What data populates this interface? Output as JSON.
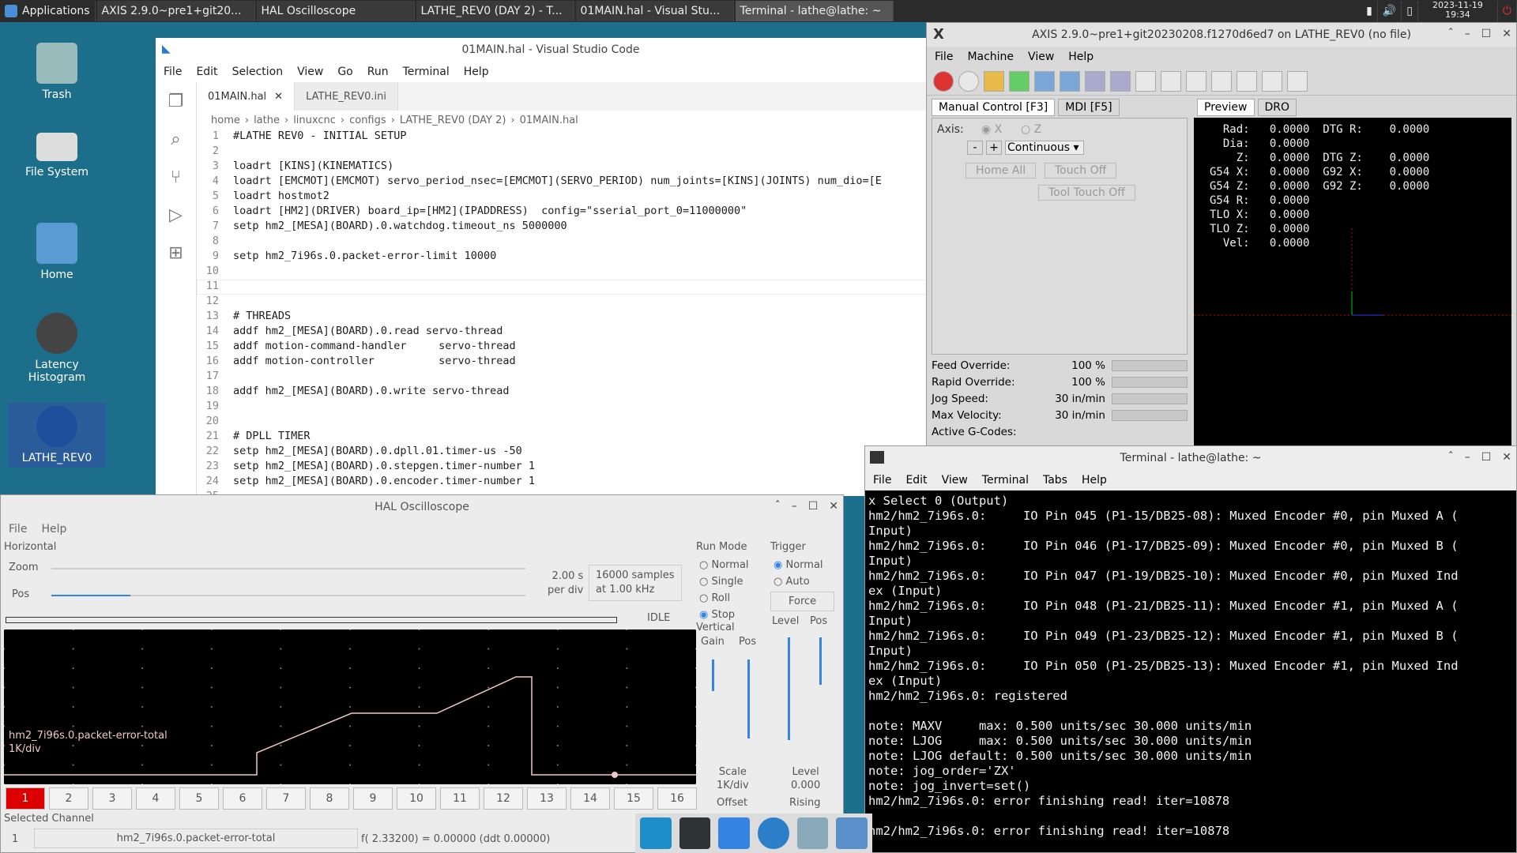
{
  "panel": {
    "applications": "Applications",
    "tasks": [
      "AXIS 2.9.0~pre1+git20...",
      "HAL Oscilloscope",
      "LATHE_REV0 (DAY 2) - T...",
      "01MAIN.hal - Visual Stu...",
      "Terminal - lathe@lathe: ~"
    ],
    "date": "2023-11-19",
    "time": "19:34"
  },
  "desktop_icons": [
    "Trash",
    "File System",
    "Home",
    "Latency Histogram",
    "LATHE_REV0"
  ],
  "vscode": {
    "title": "01MAIN.hal - Visual Studio Code",
    "menus": [
      "File",
      "Edit",
      "Selection",
      "View",
      "Go",
      "Run",
      "Terminal",
      "Help"
    ],
    "tabs": [
      "01MAIN.hal",
      "LATHE_REV0.ini"
    ],
    "breadcrumb": [
      "home",
      "lathe",
      "linuxcnc",
      "configs",
      "LATHE_REV0 (DAY 2)",
      "01MAIN.hal"
    ],
    "lines": [
      "#LATHE REV0 - INITIAL SETUP",
      "",
      "loadrt [KINS](KINEMATICS)",
      "loadrt [EMCMOT](EMCMOT) servo_period_nsec=[EMCMOT](SERVO_PERIOD) num_joints=[KINS](JOINTS) num_dio=[E",
      "loadrt hostmot2",
      "loadrt [HM2](DRIVER) board_ip=[HM2](IPADDRESS)  config=\"sserial_port_0=11000000\"",
      "setp hm2_[MESA](BOARD).0.watchdog.timeout_ns 5000000",
      "",
      "setp hm2_7i96s.0.packet-error-limit 10000",
      "",
      "",
      "",
      "# THREADS",
      "addf hm2_[MESA](BOARD).0.read servo-thread",
      "addf motion-command-handler     servo-thread",
      "addf motion-controller          servo-thread",
      "",
      "addf hm2_[MESA](BOARD).0.write servo-thread",
      "",
      "",
      "# DPLL TIMER",
      "setp hm2_[MESA](BOARD).0.dpll.01.timer-us -50",
      "setp hm2_[MESA](BOARD).0.stepgen.timer-number 1",
      "setp hm2_[MESA](BOARD).0.encoder.timer-number 1"
    ]
  },
  "axis": {
    "title": "AXIS 2.9.0~pre1+git20230208.f1270d6ed7 on LATHE_REV0 (no file)",
    "menus": [
      "File",
      "Machine",
      "View",
      "Help"
    ],
    "tabs": [
      "Manual Control [F3]",
      "MDI [F5]"
    ],
    "view_tabs": [
      "Preview",
      "DRO"
    ],
    "axis_label": "Axis:",
    "axes": [
      "X",
      "Z"
    ],
    "jog_mode": "Continuous",
    "buttons": [
      "Home All",
      "Touch Off",
      "Tool Touch Off"
    ],
    "overrides": [
      {
        "label": "Feed Override:",
        "value": "100 %"
      },
      {
        "label": "Rapid Override:",
        "value": "100 %"
      },
      {
        "label": "Jog Speed:",
        "value": "30 in/min"
      },
      {
        "label": "Max Velocity:",
        "value": "30 in/min"
      }
    ],
    "gcodes_label": "Active G-Codes:",
    "dro": "  Rad:   0.0000  DTG R:    0.0000\n  Dia:   0.0000\n    Z:   0.0000  DTG Z:    0.0000\nG54 X:   0.0000  G92 X:    0.0000\nG54 Z:   0.0000  G92 Z:    0.0000\nG54 R:   0.0000\nTLO X:   0.0000\nTLO Z:   0.0000\n  Vel:   0.0000"
  },
  "terminal": {
    "title": "Terminal - lathe@lathe: ~",
    "menus": [
      "File",
      "Edit",
      "View",
      "Terminal",
      "Tabs",
      "Help"
    ],
    "text": "x Select 0 (Output)\nhm2/hm2_7i96s.0:     IO Pin 045 (P1-15/DB25-08): Muxed Encoder #0, pin Muxed A (\nInput)\nhm2/hm2_7i96s.0:     IO Pin 046 (P1-17/DB25-09): Muxed Encoder #0, pin Muxed B (\nInput)\nhm2/hm2_7i96s.0:     IO Pin 047 (P1-19/DB25-10): Muxed Encoder #0, pin Muxed Ind\nex (Input)\nhm2/hm2_7i96s.0:     IO Pin 048 (P1-21/DB25-11): Muxed Encoder #1, pin Muxed A (\nInput)\nhm2/hm2_7i96s.0:     IO Pin 049 (P1-23/DB25-12): Muxed Encoder #1, pin Muxed B (\nInput)\nhm2/hm2_7i96s.0:     IO Pin 050 (P1-25/DB25-13): Muxed Encoder #1, pin Muxed Ind\nex (Input)\nhm2/hm2_7i96s.0: registered\n\nnote: MAXV     max: 0.500 units/sec 30.000 units/min\nnote: LJOG     max: 0.500 units/sec 30.000 units/min\nnote: LJOG default: 0.500 units/sec 30.000 units/min\nnote: jog_order='ZX'\nnote: jog_invert=set()\nhm2/hm2_7i96s.0: error finishing read! iter=10878\n\nhm2/hm2_7i96s.0: error finishing read! iter=10878"
  },
  "scope": {
    "title": "HAL Oscilloscope",
    "menus": [
      "File",
      "Help"
    ],
    "horizontal": "Horizontal",
    "zoom": "Zoom",
    "pos": "Pos",
    "per_div": "2.00 s",
    "per_div2": "per div",
    "samples": "16000 samples",
    "rate": "at 1.00 kHz",
    "state": "IDLE",
    "run_mode": "Run Mode",
    "modes": [
      "Normal",
      "Single",
      "Roll",
      "Stop"
    ],
    "trigger": "Trigger",
    "trig_modes": [
      "Normal",
      "Auto"
    ],
    "force": "Force",
    "level": "Level",
    "tpos": "Pos",
    "vertical": "Vertical",
    "gain": "Gain",
    "vpos": "Pos",
    "scale_label": "Scale",
    "scale": "1K/div",
    "offset": "Offset",
    "level_label": "Level",
    "level_value": "0.000",
    "rising": "Rising",
    "channel_label": "hm2_7i96s.0.packet-error-total",
    "channel_scale": "1K/div",
    "channels": [
      "1",
      "2",
      "3",
      "4",
      "5",
      "6",
      "7",
      "8",
      "9",
      "10",
      "11",
      "12",
      "13",
      "14",
      "15",
      "16"
    ],
    "selected": "Selected Channel",
    "sel_num": "1",
    "sel_name": "hm2_7i96s.0.packet-error-total",
    "readout": "f( 2.33200) =  0.00000 (ddt  0.00000)"
  }
}
